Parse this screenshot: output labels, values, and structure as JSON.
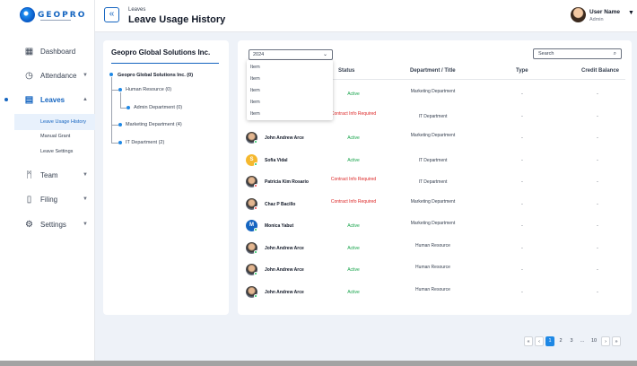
{
  "brand": {
    "logo_text": "GEOPRO"
  },
  "header": {
    "breadcrumb": "Leaves",
    "title": "Leave Usage History",
    "collapse_icon": "«"
  },
  "user": {
    "name": "User Name",
    "role": "Admin"
  },
  "sidebar": {
    "items": [
      {
        "label": "Dashboard",
        "icon": "dashboard-icon",
        "glyph": "▦"
      },
      {
        "label": "Attendance",
        "icon": "clock-icon",
        "glyph": "◷"
      },
      {
        "label": "Leaves",
        "icon": "calendar-icon",
        "glyph": "▤"
      },
      {
        "label": "Team",
        "icon": "team-icon",
        "glyph": "ᛗ"
      },
      {
        "label": "Filing",
        "icon": "file-icon",
        "glyph": "▯"
      },
      {
        "label": "Settings",
        "icon": "settings-icon",
        "glyph": "⚙"
      }
    ],
    "sub_items": [
      "Leave Usage History",
      "Manual Grant",
      "Leave Settings"
    ]
  },
  "tree": {
    "title": "Geopro Global Solutions Inc.",
    "root": "Geopro Global Solutions Inc. (0)",
    "nodes": [
      "Human Resource (0)",
      "Admin Department (0)",
      "Marketing Department (4)",
      "IT Department (2)"
    ]
  },
  "filters": {
    "year": "2024",
    "menu_items": [
      "Item",
      "Item",
      "Item",
      "Item",
      "Item"
    ],
    "search_placeholder": "Search"
  },
  "table": {
    "columns": [
      "Status",
      "Department / Title",
      "Type",
      "Credit Balance"
    ],
    "rows": [
      {
        "name": "",
        "status": "Active",
        "dept": "Marketing Department",
        "type": "-",
        "credit": "-",
        "avatar": "none",
        "dot": ""
      },
      {
        "name": "",
        "status": "Contract Info Required",
        "dept": "IT Department",
        "type": "-",
        "credit": "-",
        "avatar": "none",
        "dot": ""
      },
      {
        "name": "John Andrew Arce",
        "status": "Active",
        "dept": "Marketing Department",
        "type": "-",
        "credit": "-",
        "avatar": "photo",
        "dot": "#22c55e"
      },
      {
        "name": "Sofia Vidal",
        "status": "Active",
        "dept": "IT Department",
        "type": "-",
        "credit": "-",
        "avatar": "S",
        "dot": "#22c55e"
      },
      {
        "name": "Patricia Kim Rosario",
        "status": "Contract Info Required",
        "dept": "IT Department",
        "type": "-",
        "credit": "-",
        "avatar": "photo",
        "dot": "#ef4444"
      },
      {
        "name": "Chaz P Bacillo",
        "status": "Contract Info Required",
        "dept": "Marketing Department",
        "type": "-",
        "credit": "-",
        "avatar": "photo",
        "dot": "#ef4444"
      },
      {
        "name": "Monica Yabut",
        "status": "Active",
        "dept": "Marketing Department",
        "type": "-",
        "credit": "-",
        "avatar": "M",
        "dot": "#22c55e"
      },
      {
        "name": "John Andrew Arce",
        "status": "Active",
        "dept": "Human Resource",
        "type": "-",
        "credit": "-",
        "avatar": "photo",
        "dot": "#22c55e"
      },
      {
        "name": "John Andrew Arce",
        "status": "Active",
        "dept": "Human Resource",
        "type": "-",
        "credit": "-",
        "avatar": "photo",
        "dot": "#22c55e"
      },
      {
        "name": "John Andrew Arce",
        "status": "Active",
        "dept": "Human Resource",
        "type": "-",
        "credit": "-",
        "avatar": "photo",
        "dot": "#22c55e"
      }
    ]
  },
  "pagination": {
    "first": "«",
    "prev": "‹",
    "pages": [
      "1",
      "2",
      "3",
      "...",
      "10"
    ],
    "next": "›",
    "last": "»",
    "current": "1"
  },
  "colors": {
    "accent": "#1565c0",
    "active": "#16a34a",
    "required": "#dc2626",
    "avatar_s": "#f5b82e",
    "avatar_m": "#1565c0"
  }
}
